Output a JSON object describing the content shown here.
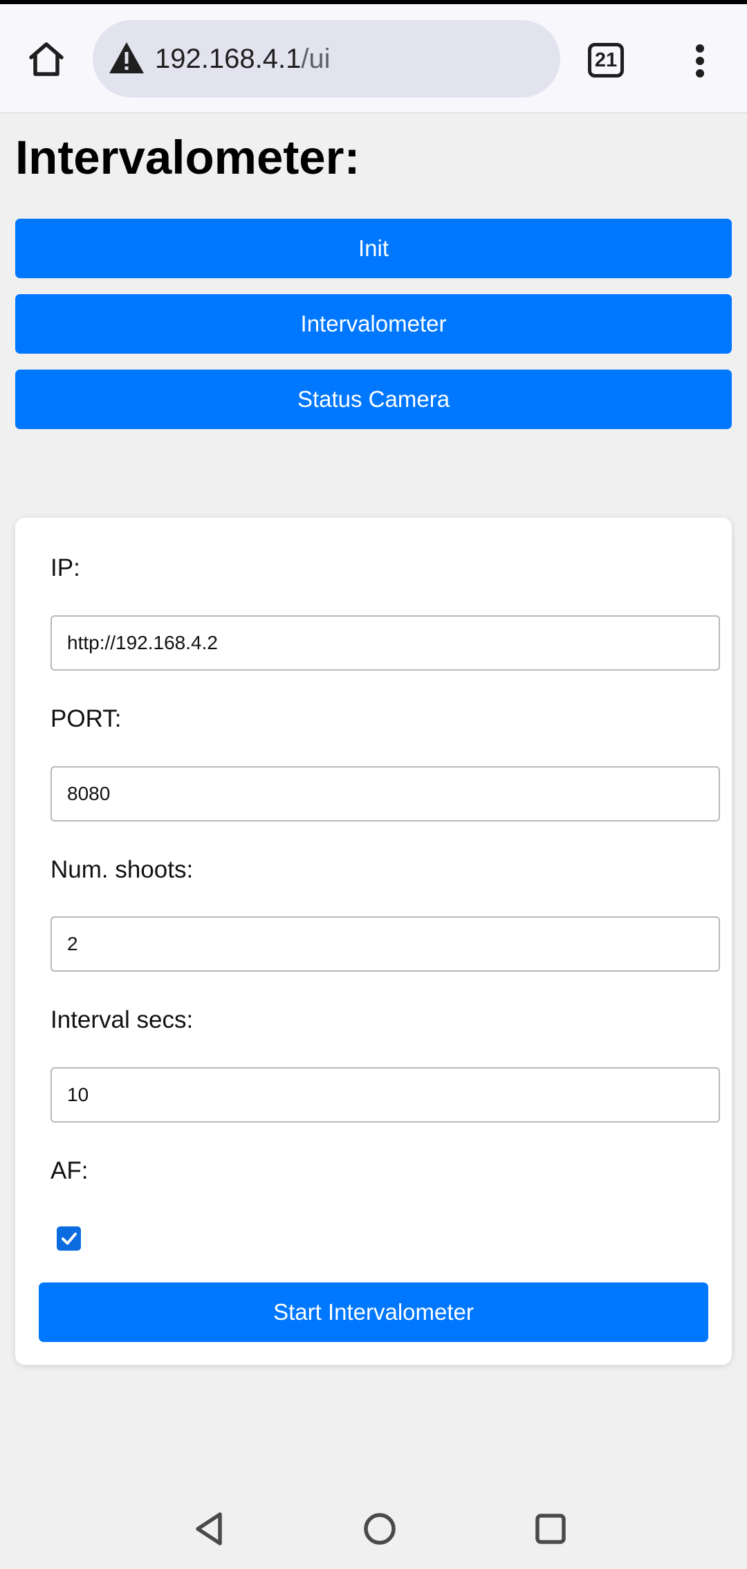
{
  "browser": {
    "url_host": "192.168.4.1",
    "url_path": "/ui",
    "tab_count": "21",
    "icons": {
      "home": "home-icon",
      "warning": "warning-icon",
      "tabs": "tabs-icon",
      "menu": "more-vert-icon"
    }
  },
  "page": {
    "title": "Intervalometer:"
  },
  "nav_buttons": [
    {
      "label": "Init"
    },
    {
      "label": "Intervalometer"
    },
    {
      "label": "Status Camera"
    }
  ],
  "form": {
    "ip_label": "IP:",
    "ip_value": "http://192.168.4.2",
    "port_label": "PORT:",
    "port_value": "8080",
    "shoots_label": "Num. shoots:",
    "shoots_value": "2",
    "interval_label": "Interval secs:",
    "interval_value": "10",
    "af_label": "AF:",
    "af_checked": true,
    "submit_label": "Start Intervalometer"
  },
  "system_nav": {
    "back": "back-triangle-icon",
    "home": "home-circle-icon",
    "recents": "recents-square-icon"
  },
  "colors": {
    "primary": "#0077ff",
    "page_bg": "#f0f0f0",
    "card_bg": "#ffffff",
    "url_pill_bg": "#e2e3ef"
  }
}
